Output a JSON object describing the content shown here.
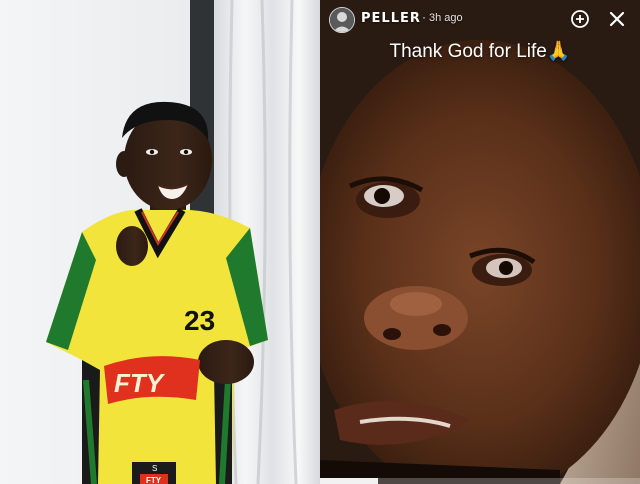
{
  "story": {
    "username": "PELLER",
    "separator": "·",
    "time_ago": "3h ago",
    "caption": "Thank God for Life🙏",
    "progress": 0.18,
    "icons": {
      "avatar": "profile-avatar",
      "add": "add-story-icon",
      "close": "close-icon"
    }
  },
  "left_photo": {
    "jersey_number": "23",
    "sponsor_text": "FTY",
    "badge_text": "FTY",
    "size_tag": "S"
  },
  "colors": {
    "jersey_yellow": "#f2e43a",
    "jersey_green": "#1f7a2e",
    "sponsor_red": "#e0301e",
    "story_bg": "#1a1410"
  }
}
